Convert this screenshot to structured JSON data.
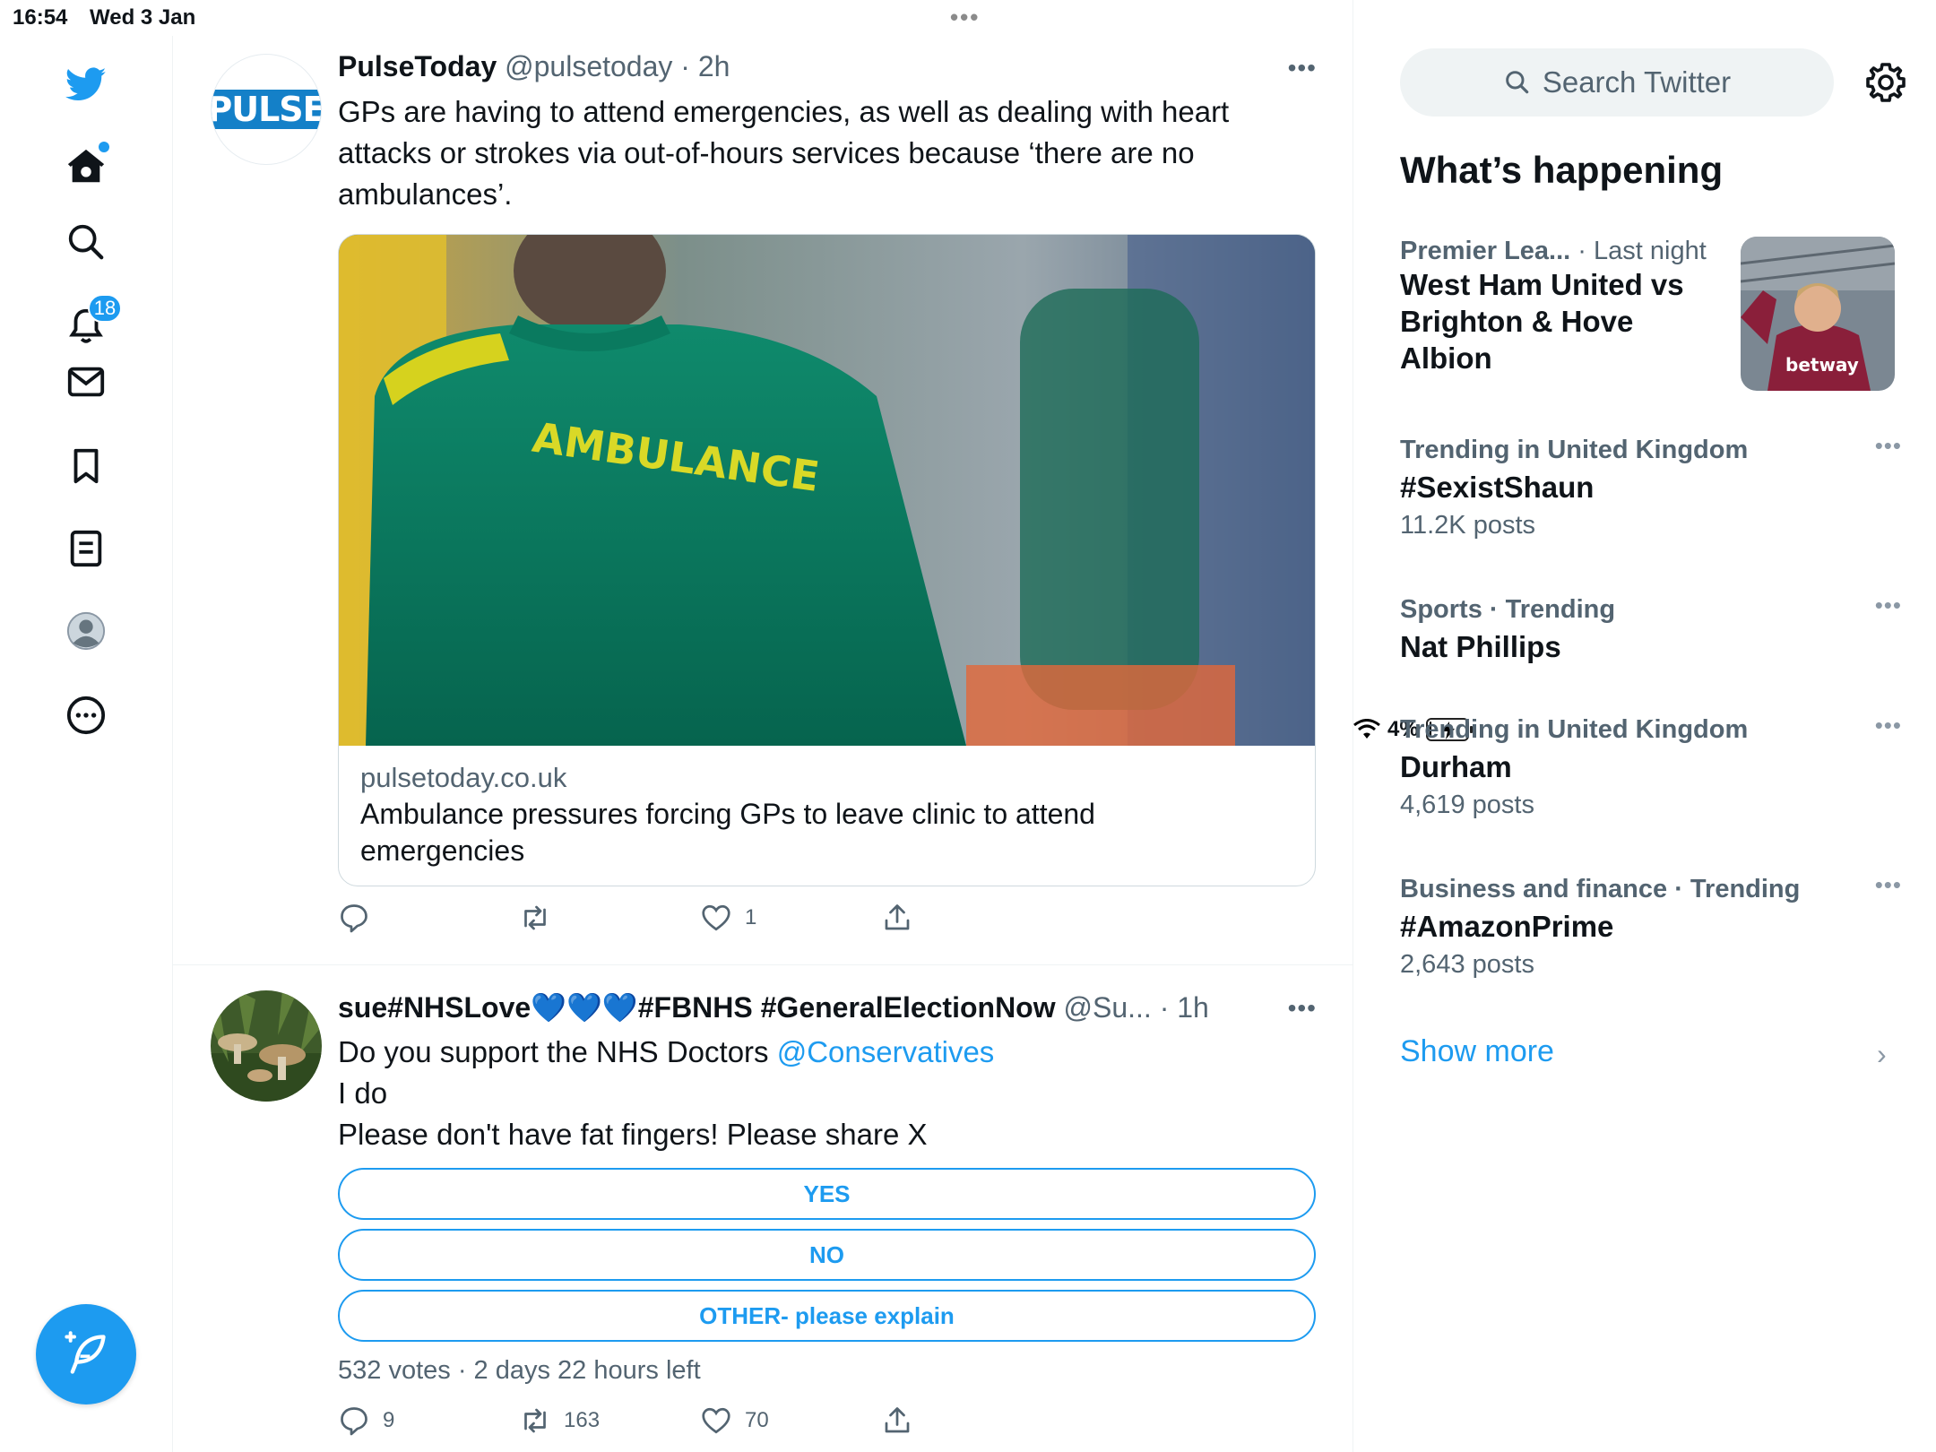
{
  "status_bar": {
    "time": "16:54",
    "date": "Wed 3 Jan",
    "battery_percent": "4%",
    "battery_level": 0.04
  },
  "nav": {
    "notifications_badge": "18"
  },
  "tweets": [
    {
      "name": "PulseToday",
      "handle": "@pulsetoday",
      "time": "· 2h",
      "avatar_text": "PULSE",
      "text_lines": [
        "GPs are having to attend emergencies, as well as dealing with heart",
        "attacks or strokes via out-of-hours services because ‘there are no",
        "ambulances’."
      ],
      "card": {
        "image_text": "AMBULANCE",
        "domain": "pulsetoday.co.uk",
        "title_lines": [
          "Ambulance pressures forcing GPs to leave clinic to attend",
          "emergencies"
        ]
      },
      "likes": "1"
    },
    {
      "name": "sue#NHSLove💙💙💙#FBNHS #GeneralElectionNow",
      "handle": "@Su...",
      "time": "· 1h",
      "text_line1": "Do you support the NHS Doctors",
      "mention": "@Conservatives",
      "text_line2": "I do",
      "text_line3": "Please don't have fat fingers! Please share X",
      "poll": {
        "options": [
          "YES",
          "NO",
          "OTHER- please explain"
        ],
        "meta": "532 votes · 2 days 22 hours left"
      },
      "replies": "9",
      "retweets": "163",
      "likes": "70"
    }
  ],
  "sidebar": {
    "search_placeholder": "Search Twitter",
    "title": "What’s happening",
    "trends": [
      {
        "context": "Premier Lea...",
        "context_extra": "· Last night",
        "title_lines": [
          "West Ham United vs",
          "Brighton & Hove",
          "Albion"
        ],
        "image_text": "betway"
      },
      {
        "context": "Trending in United Kingdom",
        "title": "#SexistShaun",
        "count": "11.2K posts"
      },
      {
        "context": "Sports · Trending",
        "title": "Nat Phillips"
      },
      {
        "context": "Trending in United Kingdom",
        "title": "Durham",
        "count": "4,619 posts"
      },
      {
        "context": "Business and finance · Trending",
        "title": "#AmazonPrime",
        "count": "2,643 posts"
      }
    ],
    "show_more": "Show more"
  },
  "colors": {
    "accent": "#1d9bf0",
    "text": "#0f1419",
    "secondary": "#536471"
  }
}
